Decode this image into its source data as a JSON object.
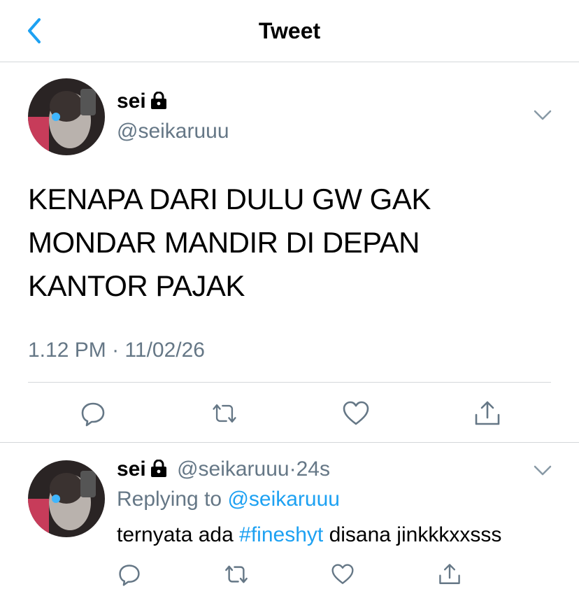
{
  "header": {
    "title": "Tweet"
  },
  "tweet": {
    "name": "sei",
    "handle": "@seikaruuu",
    "text_lines": [
      "KENAPA DARI DULU GW GAK",
      "MONDAR MANDIR DI DEPAN",
      "KANTOR PAJAK"
    ],
    "time": "1.12 PM",
    "dot": "·",
    "date": "11/02/26"
  },
  "reply": {
    "name": "sei",
    "handle": "@seikaruuu",
    "dot": "·",
    "age": "24s",
    "replying_label": "Replying to",
    "replying_handle": "@seikaruuu",
    "text_before": "ternyata ada",
    "hashtag": "#fineshyt",
    "text_after": "disana jinkkkxxsss"
  },
  "colors": {
    "accent": "#1da1f2",
    "secondary_text": "#657786",
    "icon": "#657786",
    "divider": "#d4d7da"
  },
  "icons": [
    "back-chevron-icon",
    "lock-icon",
    "chevron-down-icon",
    "reply-icon",
    "retweet-icon",
    "like-icon",
    "share-icon"
  ]
}
